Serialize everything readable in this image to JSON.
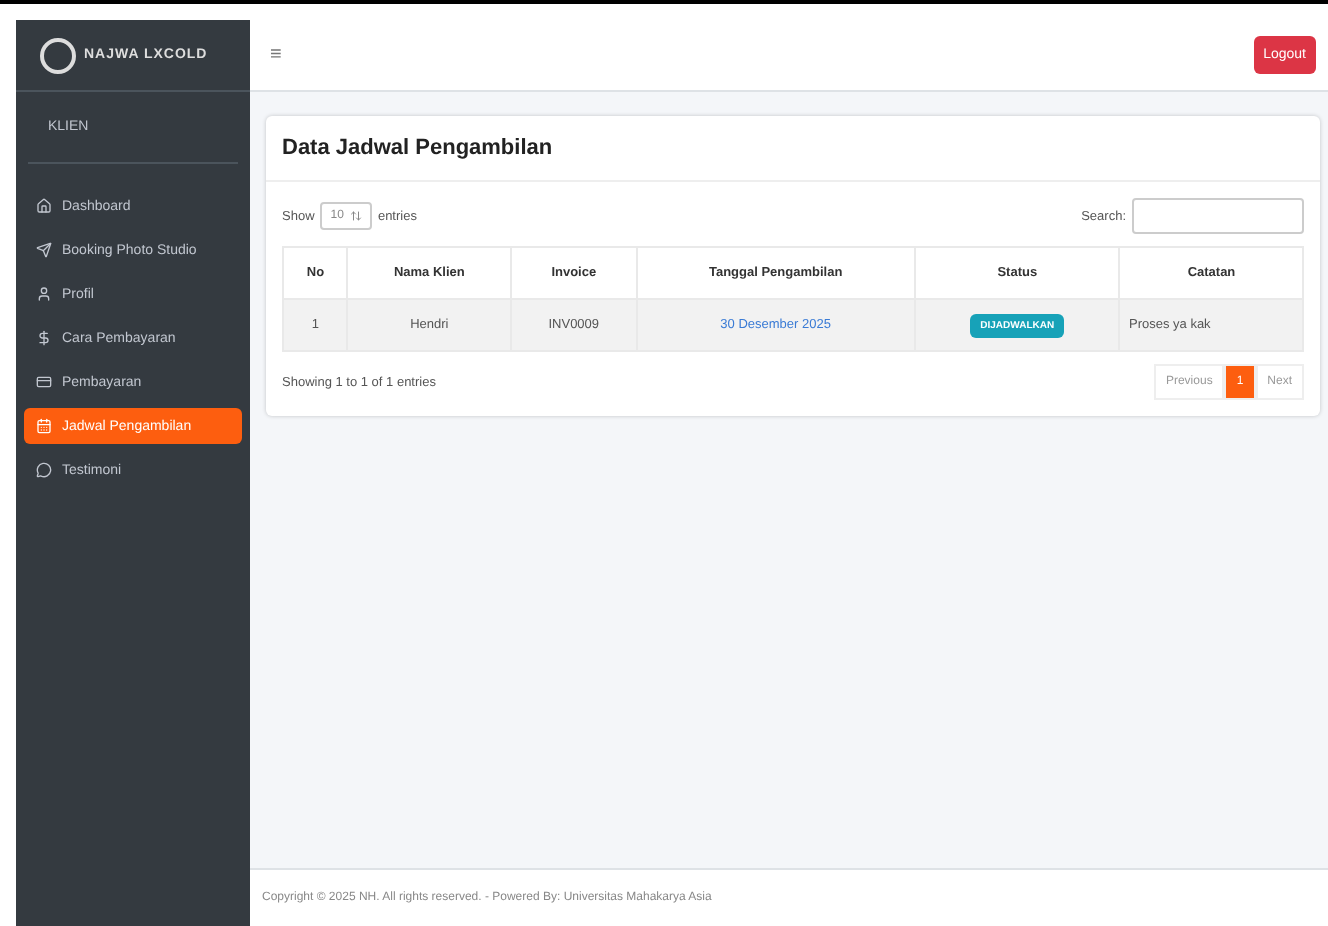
{
  "sidebar": {
    "brand": "NAJWA LXCOLD",
    "section": "KLIEN",
    "items": [
      {
        "kind": "home",
        "label": "Dashboard",
        "selected": false
      },
      {
        "kind": "send",
        "label": "Booking Photo Studio",
        "selected": false
      },
      {
        "kind": "user",
        "label": "Profil",
        "selected": false
      },
      {
        "kind": "dollar",
        "label": "Cara Pembayaran",
        "selected": false
      },
      {
        "kind": "card",
        "label": "Pembayaran",
        "selected": false
      },
      {
        "kind": "calendar",
        "label": "Jadwal Pengambilan",
        "selected": true
      },
      {
        "kind": "chat",
        "label": "Testimoni",
        "selected": false
      }
    ]
  },
  "topbar": {
    "menu_glyph": "≡",
    "logout": "Logout"
  },
  "card": {
    "title": "Data Jadwal Pengambilan",
    "show_label": "Show",
    "page_size": "10",
    "entries_label": "entries",
    "search_label": "Search:",
    "columns": [
      "No",
      "Nama Klien",
      "Invoice",
      "Tanggal Pengambilan",
      "Status",
      "Catatan"
    ],
    "rows": [
      {
        "no": "1",
        "client": "Hendri",
        "invoice": "INV0009",
        "date": "30 Desember 2025",
        "status": "DIJADWALKAN",
        "note": "Proses ya kak"
      }
    ],
    "info": "Showing 1 to 1 of 1 entries",
    "pagination": [
      {
        "label": "Previous",
        "selected": false
      },
      {
        "label": "1",
        "selected": true
      },
      {
        "label": "Next",
        "selected": false
      }
    ]
  },
  "footer": "Copyright © 2025 NH. All rights reserved. - Powered By: Universitas Mahakarya Asia"
}
